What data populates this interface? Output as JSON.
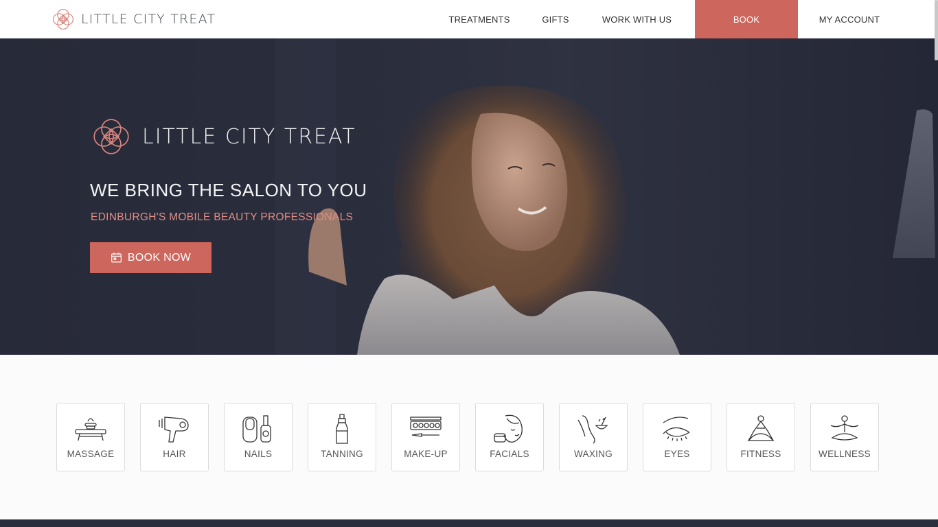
{
  "brand": {
    "name": "LITTLE CITY TREAT"
  },
  "nav": {
    "items": [
      {
        "label": "TREATMENTS"
      },
      {
        "label": "GIFTS"
      },
      {
        "label": "WORK WITH US"
      },
      {
        "label": "BOOK"
      },
      {
        "label": "MY ACCOUNT"
      }
    ]
  },
  "hero": {
    "logo_text": "LITTLE CITY TREAT",
    "title": "WE BRING THE SALON TO YOU",
    "subtitle": "EDINBURGH'S MOBILE BEAUTY PROFESSIONALS",
    "cta_label": "BOOK NOW"
  },
  "services": [
    {
      "label": "MASSAGE",
      "icon": "massage-table-icon"
    },
    {
      "label": "HAIR",
      "icon": "hair-dryer-icon"
    },
    {
      "label": "NAILS",
      "icon": "nail-polish-icon"
    },
    {
      "label": "TANNING",
      "icon": "spray-bottle-icon"
    },
    {
      "label": "MAKE-UP",
      "icon": "makeup-palette-icon"
    },
    {
      "label": "FACIALS",
      "icon": "face-cream-icon"
    },
    {
      "label": "WAXING",
      "icon": "wax-leg-icon"
    },
    {
      "label": "EYES",
      "icon": "eye-brow-icon"
    },
    {
      "label": "FITNESS",
      "icon": "yoga-pose-icon"
    },
    {
      "label": "WELLNESS",
      "icon": "meditation-icon"
    }
  ],
  "colors": {
    "accent": "#cd665c",
    "accent_light": "#e28d85",
    "hero_dark": "#272a38",
    "text_dark": "#3c3f4a"
  }
}
